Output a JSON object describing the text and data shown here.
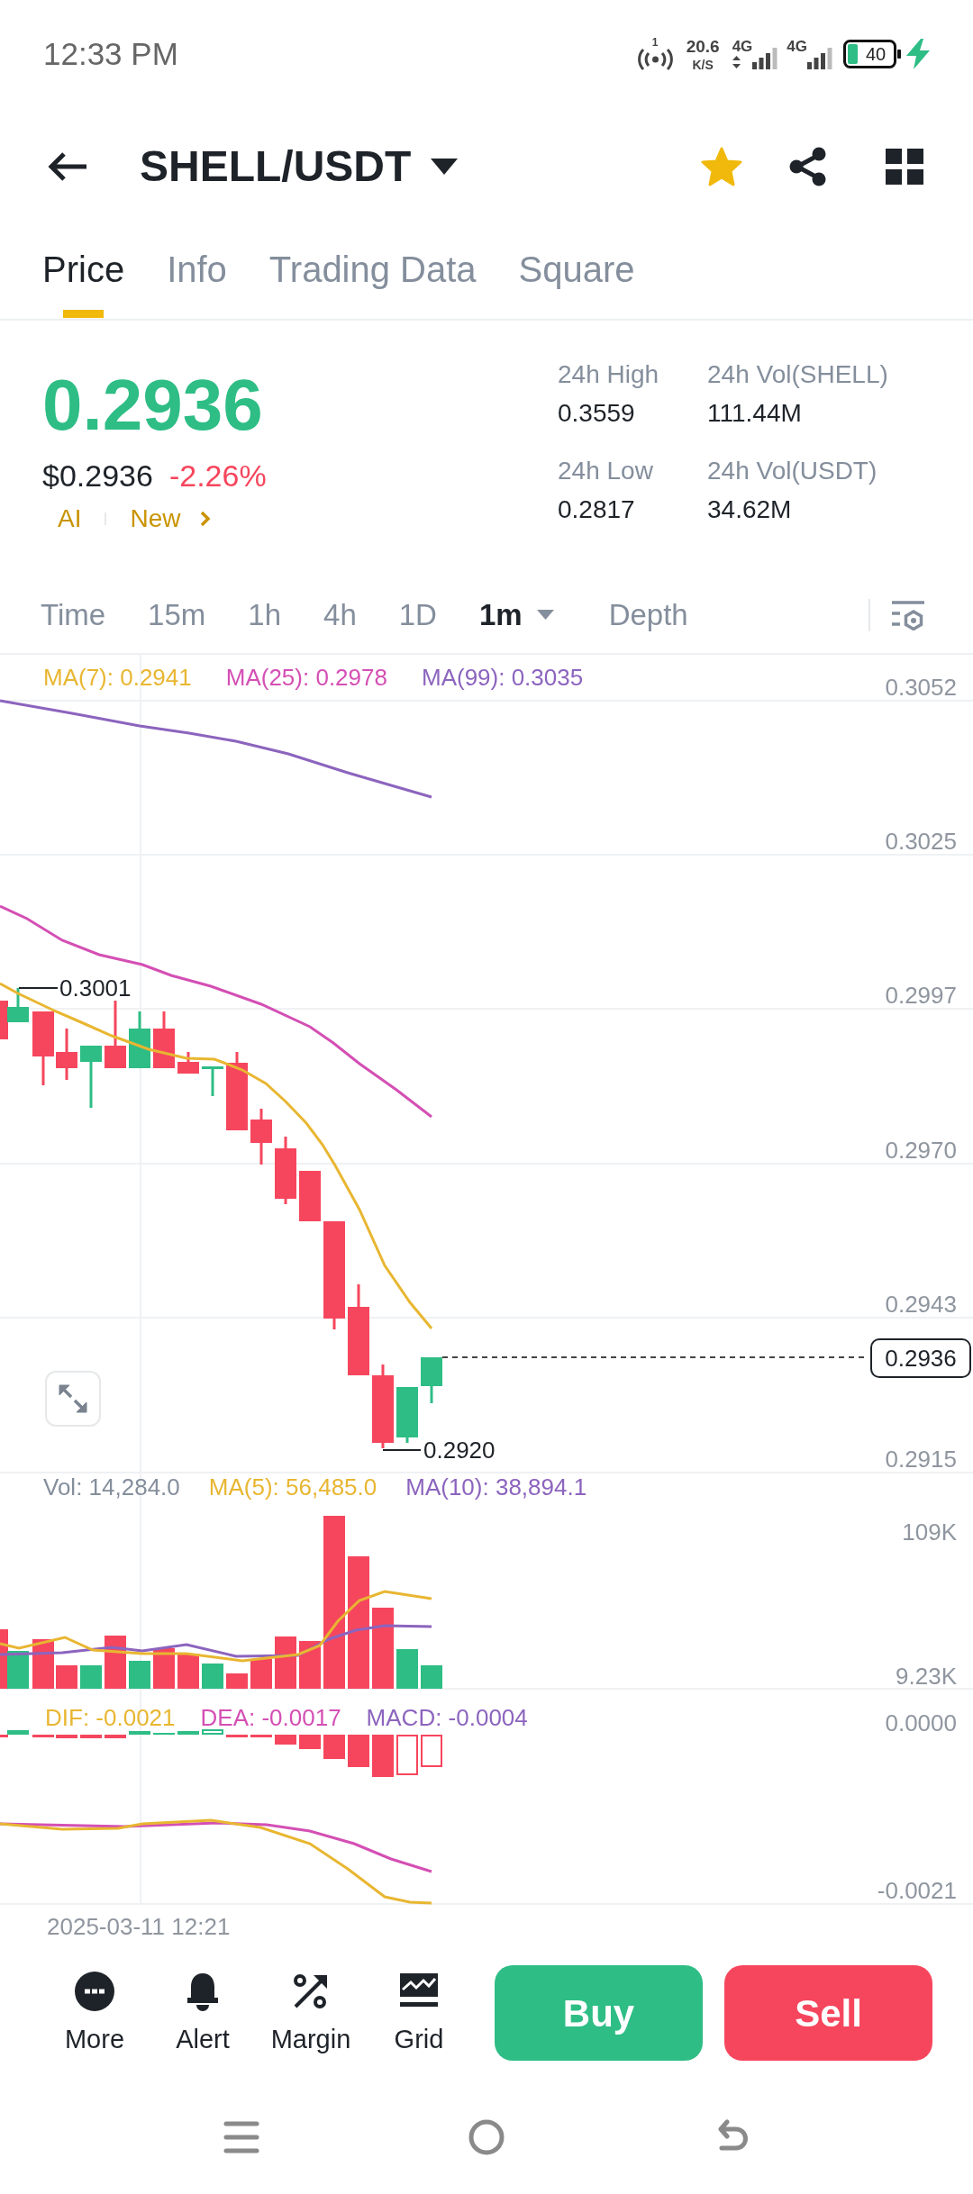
{
  "status_bar": {
    "time": "12:33 PM",
    "hotspot_count": "1",
    "speed": "20.6",
    "speed_unit": "K/S",
    "networks": [
      "4G",
      "4G"
    ],
    "battery": "40"
  },
  "header": {
    "pair": "SHELL/USDT",
    "favorite": true
  },
  "tabs": [
    {
      "label": "Price",
      "selected": true
    },
    {
      "label": "Info",
      "selected": false
    },
    {
      "label": "Trading Data",
      "selected": false
    },
    {
      "label": "Square",
      "selected": false
    }
  ],
  "ticker": {
    "price": "0.2936",
    "usd_price": "$0.2936",
    "change": "-2.26%",
    "tags": [
      "AI",
      "New"
    ]
  },
  "stats": [
    {
      "label": "24h High",
      "value": "0.3559"
    },
    {
      "label": "24h Vol(SHELL)",
      "value": "111.44M"
    },
    {
      "label": "24h Low",
      "value": "0.2817"
    },
    {
      "label": "24h Vol(USDT)",
      "value": "34.62M"
    }
  ],
  "intervals": [
    {
      "label": "Time",
      "kind": "tab",
      "selected": false
    },
    {
      "label": "15m",
      "kind": "tab",
      "selected": false
    },
    {
      "label": "1h",
      "kind": "tab",
      "selected": false
    },
    {
      "label": "4h",
      "kind": "tab",
      "selected": false
    },
    {
      "label": "1D",
      "kind": "tab",
      "selected": false
    },
    {
      "label": "1m",
      "kind": "dropdown",
      "selected": true
    },
    {
      "label": "Depth",
      "kind": "tab",
      "selected": false
    }
  ],
  "price_chart": {
    "legend": [
      {
        "label": "MA(7): 0.2941",
        "color": "#e8b631"
      },
      {
        "label": "MA(25): 0.2978",
        "color": "#d44fb4"
      },
      {
        "label": "MA(99): 0.3035",
        "color": "#8c64be"
      }
    ],
    "axis": [
      "0.3052",
      "0.3025",
      "0.2997",
      "0.2970",
      "0.2943",
      "0.2915"
    ],
    "high_label": "0.3001",
    "low_label": "0.2920",
    "last_price": "0.2936"
  },
  "volume_chart": {
    "legend": [
      {
        "label": "Vol: 14,284.0",
        "color": "#848e9c"
      },
      {
        "label": "MA(5): 56,485.0",
        "color": "#e8b631"
      },
      {
        "label": "MA(10): 38,894.1",
        "color": "#8c64be"
      }
    ],
    "axis": [
      "109K",
      "9.23K"
    ]
  },
  "macd_chart": {
    "legend": [
      {
        "label": "DIF: -0.0021",
        "color": "#e8b631"
      },
      {
        "label": "DEA: -0.0017",
        "color": "#d44fb4"
      },
      {
        "label": "MACD: -0.0004",
        "color": "#8c64be"
      }
    ],
    "axis": [
      "0.0000",
      "-0.0021"
    ]
  },
  "time_label": "2025-03-11 12:21",
  "actions": [
    {
      "label": "More"
    },
    {
      "label": "Alert"
    },
    {
      "label": "Margin"
    },
    {
      "label": "Grid"
    }
  ],
  "trade_buttons": [
    {
      "label": "Buy",
      "kind": "buy"
    },
    {
      "label": "Sell",
      "kind": "sell"
    }
  ]
}
